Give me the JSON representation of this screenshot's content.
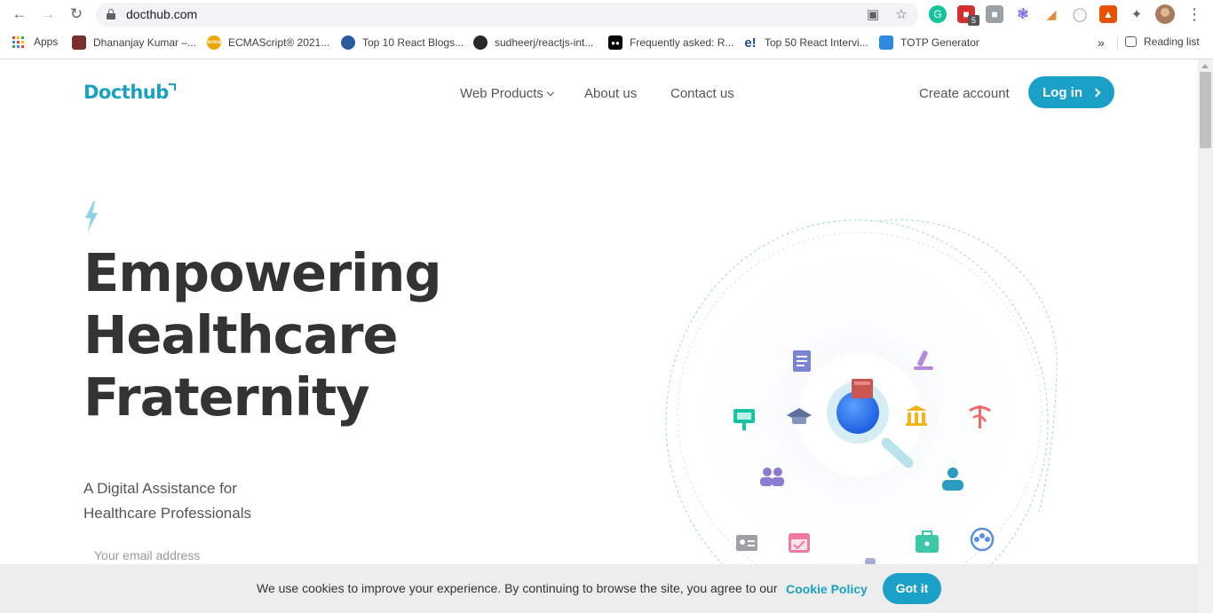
{
  "browser": {
    "url": "docthub.com",
    "extension_badge": "5",
    "reading_list_label": "Reading list",
    "overflow_label": "»",
    "bookmarks": [
      {
        "label": "Apps",
        "icon": "apps-grid-icon"
      },
      {
        "label": "Dhananjay Kumar –...",
        "icon": "dhananjay-favicon",
        "color": "#7a2f2f"
      },
      {
        "label": "ECMAScript® 2021...",
        "icon": "ecma-favicon",
        "color": "#f0a500"
      },
      {
        "label": "Top 10 React Blogs...",
        "icon": "blog-favicon",
        "color": "#2c5aa0"
      },
      {
        "label": "sudheerj/reactjs-int...",
        "icon": "github-favicon",
        "color": "#24292e"
      },
      {
        "label": "Frequently asked: R...",
        "icon": "medium-favicon",
        "color": "#000000"
      },
      {
        "label": "Top 50 React Intervi...",
        "icon": "edureka-favicon",
        "color": "#1d4b8f"
      },
      {
        "label": "TOTP Generator",
        "icon": "totp-favicon",
        "color": "#2e8ade"
      }
    ]
  },
  "site": {
    "logo": "Docthub",
    "nav": {
      "web_products": "Web Products",
      "about": "About us",
      "contact": "Contact us",
      "create_account": "Create account",
      "login": "Log in"
    },
    "hero": {
      "title_lines": [
        "Empowering",
        "Healthcare",
        "Fraternity"
      ],
      "subtitle_lines": [
        "A Digital Assistance for",
        "Healthcare Professionals"
      ],
      "email_placeholder": "Your email address"
    },
    "cookie": {
      "text": "We use cookies to improve your experience. By continuing to browse the site, you agree to our",
      "link": "Cookie Policy",
      "button": "Got it"
    },
    "colors": {
      "brand": "#1aa1c1",
      "button": "#1ba0c8",
      "text": "#333333"
    }
  }
}
